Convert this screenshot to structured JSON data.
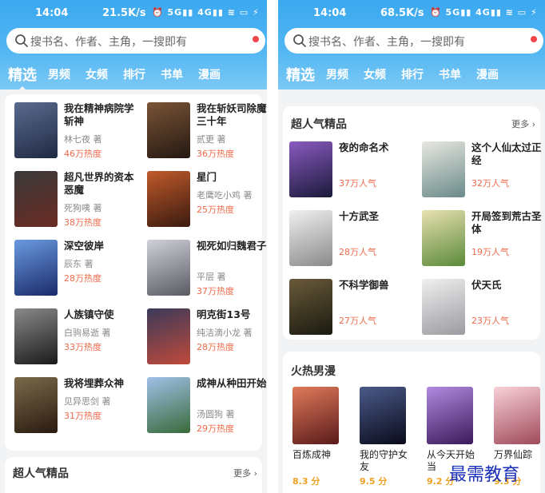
{
  "watermark": "最需教育",
  "left": {
    "status": {
      "time": "14:04",
      "speed": "21.5K/s",
      "icons": "⏰ 5G▮▮ 4G▮▮ ≋ ▭ ⚡"
    },
    "search": {
      "placeholder": "搜书名、作者、主角，一搜即有"
    },
    "tabs": [
      "精选",
      "男频",
      "女频",
      "排行",
      "书单",
      "漫画"
    ],
    "books": [
      {
        "title": "我在精神病院学斩神",
        "author": "林七夜 著",
        "heat": "46万热度",
        "color": "#3b4a6e"
      },
      {
        "title": "我在斩妖司除魔三十年",
        "author": "贰更 著",
        "heat": "36万热度",
        "color": "#4a3426"
      },
      {
        "title": "超凡世界的资本恶魔",
        "author": "死狗咦 著",
        "heat": "38万热度",
        "color": "#5a2a22"
      },
      {
        "title": "星门",
        "author": "老鹰吃小鸡 著",
        "heat": "25万热度",
        "color": "#7a2a1a"
      },
      {
        "title": "深空彼岸",
        "author": "辰东 著",
        "heat": "28万热度",
        "color": "#2a4a9a"
      },
      {
        "title": "视死如归魏君子",
        "author": "平层 著",
        "heat": "37万热度",
        "color": "#8a8a92"
      },
      {
        "title": "人族镇守使",
        "author": "白驹易逝 著",
        "heat": "33万热度",
        "color": "#3a3a3a"
      },
      {
        "title": "明克街13号",
        "author": "纯洁滴小龙 著",
        "heat": "28万热度",
        "color": "#2a2a38"
      },
      {
        "title": "我将埋葬众神",
        "author": "见异思剑 著",
        "heat": "31万热度",
        "color": "#4a3a2a"
      },
      {
        "title": "成神从种田开始",
        "author": "汤圆狗 著",
        "heat": "29万热度",
        "color": "#6a8ac0"
      }
    ],
    "section2": {
      "title": "超人气精品",
      "more": "更多"
    }
  },
  "right": {
    "status": {
      "time": "14:04",
      "speed": "68.5K/s",
      "icons": "⏰ 5G▮▮ 4G▮▮ ≋ ▭ ⚡"
    },
    "search": {
      "placeholder": "搜书名、作者、主角，一搜即有"
    },
    "tabs": [
      "精选",
      "男频",
      "女频",
      "排行",
      "书单",
      "漫画"
    ],
    "section1": {
      "title": "超人气精品",
      "more": "更多"
    },
    "books": [
      {
        "title": "夜的命名术",
        "heat": "37万人气",
        "color": "#4a2a6a"
      },
      {
        "title": "这个人仙太过正经",
        "heat": "32万人气",
        "color": "#8a9aa0"
      },
      {
        "title": "十方武圣",
        "heat": "28万人气",
        "color": "#c8c8c8"
      },
      {
        "title": "开局签到荒古圣体",
        "heat": "19万人气",
        "color": "#7aa05a"
      },
      {
        "title": "不科学御兽",
        "heat": "27万人气",
        "color": "#3a3a2a"
      },
      {
        "title": "伏天氏",
        "heat": "23万人气",
        "color": "#9aa0aa"
      }
    ],
    "section2": {
      "title": "火热男漫"
    },
    "manga": [
      {
        "title": "百炼成神",
        "score": "8.3 分",
        "color": "#c04a3a"
      },
      {
        "title": "我的守护女友",
        "score": "9.5 分",
        "color": "#2a3a5a"
      },
      {
        "title": "从今天开始当",
        "score": "9.2 分",
        "color": "#6a4aaa"
      },
      {
        "title": "万界仙踪",
        "score": "9.3 分",
        "color": "#e0a0b0"
      }
    ]
  }
}
